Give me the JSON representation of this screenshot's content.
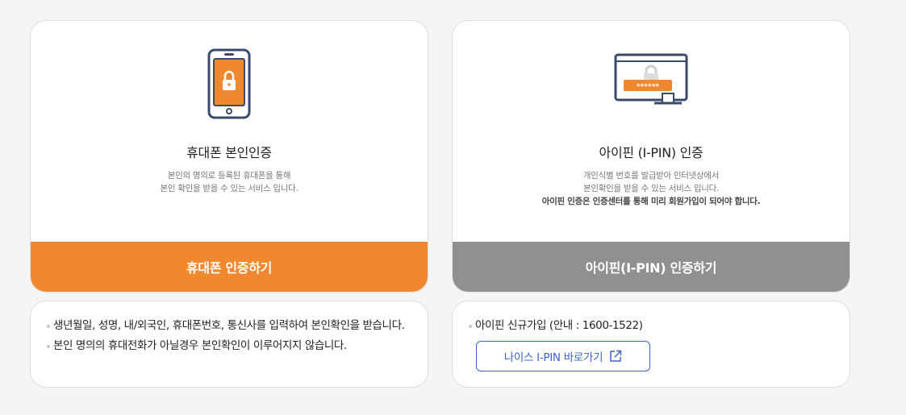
{
  "phone_card": {
    "title": "휴대폰 본인인증",
    "desc_line1": "본인의 명의로 등록된 휴대폰을 통해",
    "desc_line2": "본인 확인을 받을 수 있는 서비스 입니다.",
    "action_label": "휴대폰 인증하기",
    "icon": "phone-lock-icon",
    "accent": "#f0882f"
  },
  "ipin_card": {
    "title": "아이핀 (I-PIN) 인증",
    "desc_line1": "개인식별 번호를 발급받아 인터넷상에서",
    "desc_line2": "본인확인을 받을 수 있는 서비스 입니다.",
    "desc_line3": "아이핀 인증은 인증센터를 통해 미리 회원가입이 되어야 합니다.",
    "action_label": "아이핀(I-PIN) 인증하기",
    "icon": "monitor-password-icon",
    "password_mask": "******",
    "accent": "#909090"
  },
  "phone_info": {
    "items": [
      "생년월일, 성명, 내/외국인, 휴대폰번호, 통신사를 입력하여 본인확인을 받습니다.",
      "본인 명의의 휴대전화가 아닐경우 본인확인이 이루어지지 않습니다."
    ]
  },
  "ipin_info": {
    "items": [
      "아이핀 신규가입 (안내 : 1600-1522)"
    ],
    "link_label": "나이스 I-PIN 바로가기",
    "link_icon": "external-link-icon",
    "link_color": "#3d63c9"
  }
}
